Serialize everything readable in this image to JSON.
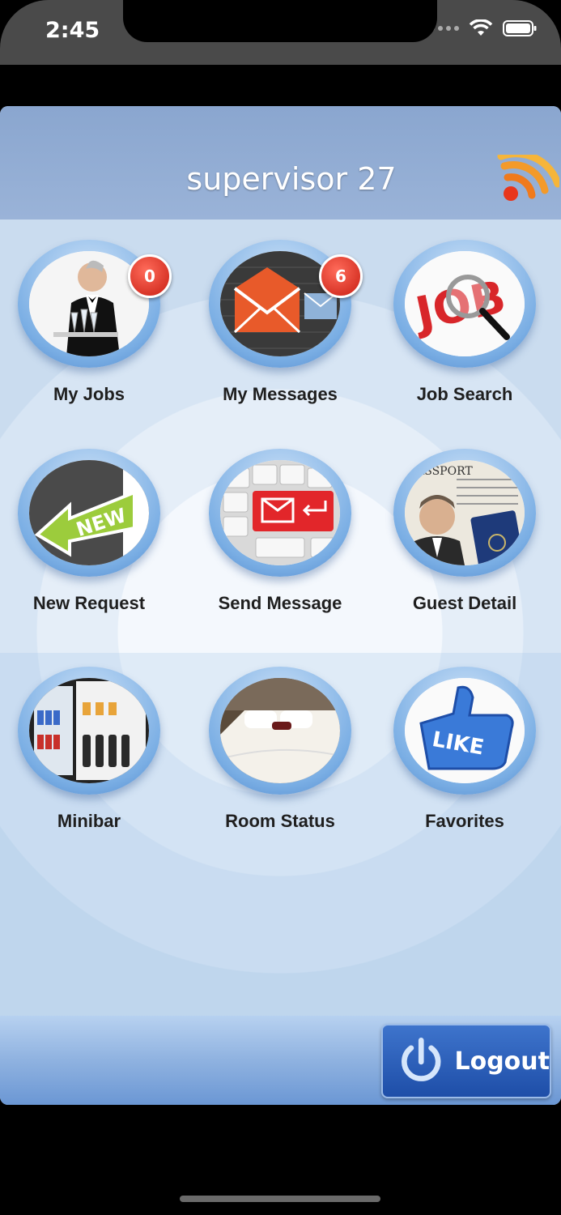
{
  "status_bar": {
    "time": "2:45"
  },
  "header": {
    "title": "supervisor 27"
  },
  "tiles": [
    {
      "label": "My Jobs",
      "badge": "0"
    },
    {
      "label": "My Messages",
      "badge": "6"
    },
    {
      "label": "Job Search"
    },
    {
      "label": "New Request",
      "image_text": "NEW"
    },
    {
      "label": "Send Message"
    },
    {
      "label": "Guest Detail",
      "image_text": "PASSPORT"
    },
    {
      "label": "Minibar"
    },
    {
      "label": "Room Status"
    },
    {
      "label": "Favorites",
      "image_text": "LIKE"
    }
  ],
  "footer": {
    "logout_label": "Logout"
  },
  "colors": {
    "header": "#8aa6cf",
    "badge": "#d8281b",
    "logout": "#2a5cb8"
  }
}
